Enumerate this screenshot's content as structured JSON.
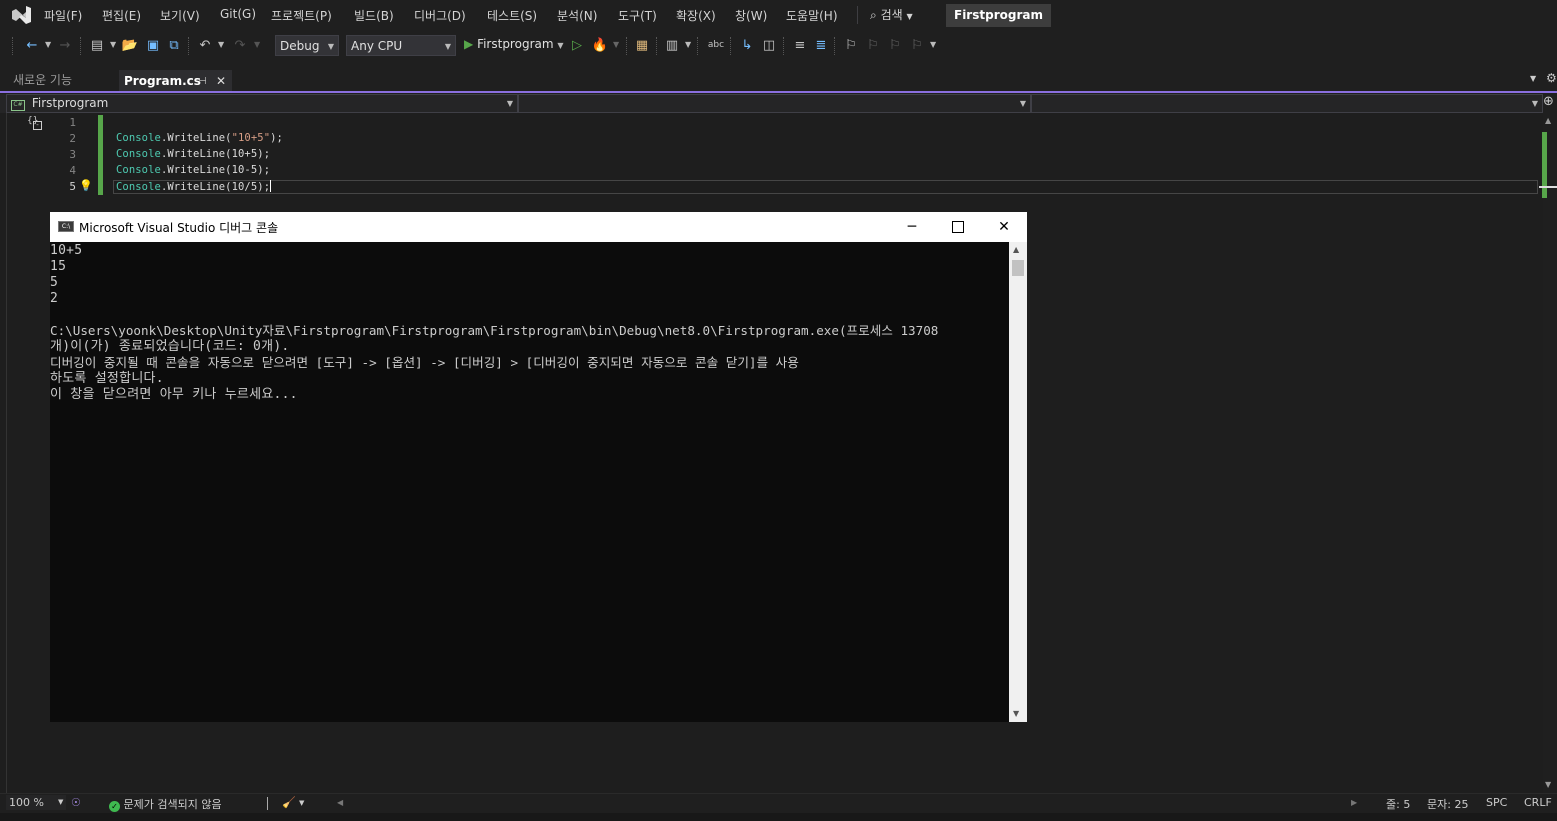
{
  "menubar": {
    "items": [
      "파일(F)",
      "편집(E)",
      "보기(V)",
      "Git(G)",
      "프로젝트(P)",
      "빌드(B)",
      "디버그(D)",
      "테스트(S)",
      "분석(N)",
      "도구(T)",
      "확장(X)",
      "창(W)",
      "도움말(H)"
    ],
    "search_label": "검색",
    "solution_title": "Firstprogram"
  },
  "toolbar": {
    "config": "Debug",
    "platform": "Any CPU",
    "start_label": "Firstprogram"
  },
  "tabs": [
    {
      "label": "새로운 기능",
      "active": false
    },
    {
      "label": "Program.cs",
      "active": true
    }
  ],
  "navbar": {
    "project": "Firstprogram"
  },
  "editor": {
    "line_numbers": [
      "1",
      "2",
      "3",
      "4",
      "5"
    ],
    "lines": [
      {
        "cls": "",
        "rest": ""
      },
      {
        "cls": "Console",
        "rest": ".WriteLine(",
        "str": "\"10+5\"",
        "end": ");"
      },
      {
        "cls": "Console",
        "rest": ".WriteLine(10+5);"
      },
      {
        "cls": "Console",
        "rest": ".WriteLine(10-5);"
      },
      {
        "cls": "Console",
        "rest": ".WriteLine(10/5);"
      }
    ]
  },
  "console": {
    "title": "Microsoft Visual Studio 디버그 콘솔",
    "icon_text": "C:\\",
    "lines": [
      "10+5",
      "15",
      "5",
      "2",
      "",
      "C:\\Users\\yoonk\\Desktop\\Unity자료\\Firstprogram\\Firstprogram\\Firstprogram\\bin\\Debug\\net8.0\\Firstprogram.exe(프로세스 13708",
      "개)이(가) 종료되었습니다(코드: 0개).",
      "디버깅이 중지될 때 콘솔을 자동으로 닫으려면 [도구] -> [옵션] -> [디버깅] > [디버깅이 중지되면 자동으로 콘솔 닫기]를 사용",
      "하도록 설정합니다.",
      "이 창을 닫으려면 아무 키나 누르세요..."
    ]
  },
  "statusbar": {
    "zoom": "100 %",
    "issues": "문제가 검색되지 않음",
    "line": "줄: 5",
    "char": "문자: 25",
    "spc": "SPC",
    "crlf": "CRLF"
  },
  "colors": {
    "accent": "#8a6fdf",
    "change_bar": "#57a64a",
    "class_name": "#4ec9b0",
    "string": "#d69d85"
  }
}
